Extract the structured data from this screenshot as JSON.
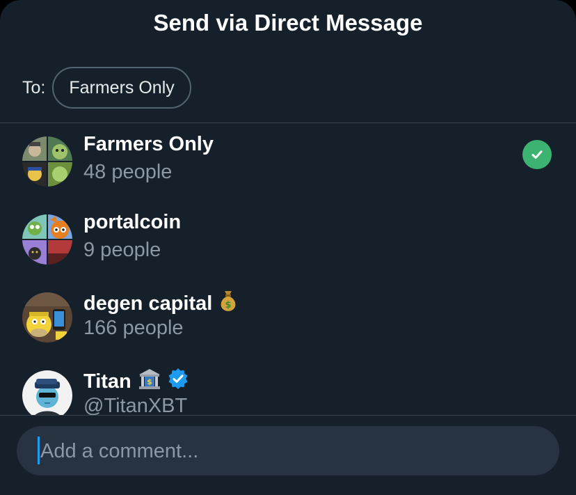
{
  "header": {
    "title": "Send via Direct Message"
  },
  "recipients": {
    "to_label": "To:",
    "selected": [
      "Farmers Only"
    ]
  },
  "conversations": [
    {
      "name": "Farmers Only",
      "subtitle": "48 people",
      "selected": true
    },
    {
      "name": "portalcoin",
      "subtitle": "9 people",
      "selected": false
    },
    {
      "name": "degen capital",
      "name_emoji": "money-bag",
      "subtitle": "166 people",
      "selected": false
    },
    {
      "name": "Titan",
      "name_emoji": "bank",
      "verified": true,
      "subtitle": "@TitanXBT",
      "selected": false
    }
  ],
  "comment": {
    "placeholder": "Add a comment..."
  },
  "colors": {
    "background": "#15202b",
    "check": "#3cb371",
    "verified": "#1d9bf0",
    "input_bg": "#273340"
  }
}
